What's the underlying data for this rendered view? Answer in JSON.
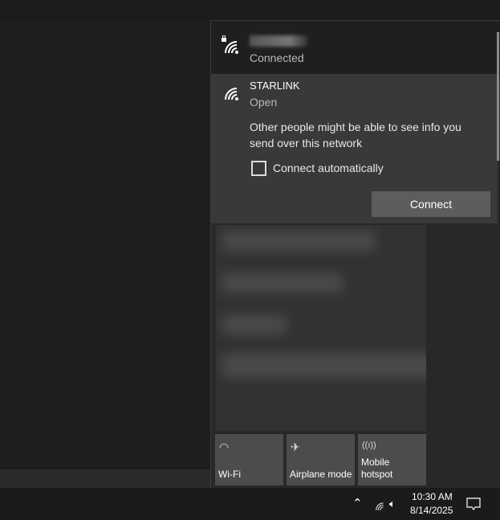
{
  "networks": [
    {
      "name": "",
      "status": "Connected",
      "secured": true,
      "icon": "wifi-lock-icon"
    },
    {
      "name": "STARLINK",
      "status": "Open",
      "icon": "wifi-icon",
      "warning": "Other people might be able to see info you send over this network",
      "connect_automatically_label": "Connect automatically",
      "connect_automatically": false,
      "connect_label": "Connect"
    }
  ],
  "quick_actions": [
    {
      "label": "Wi-Fi",
      "icon": "wifi-icon"
    },
    {
      "label": "Airplane mode",
      "icon": "airplane-icon"
    },
    {
      "label": "Mobile hotspot",
      "icon": "hotspot-icon"
    }
  ],
  "taskbar": {
    "time": "10:30 AM",
    "date": "8/14/2025"
  }
}
